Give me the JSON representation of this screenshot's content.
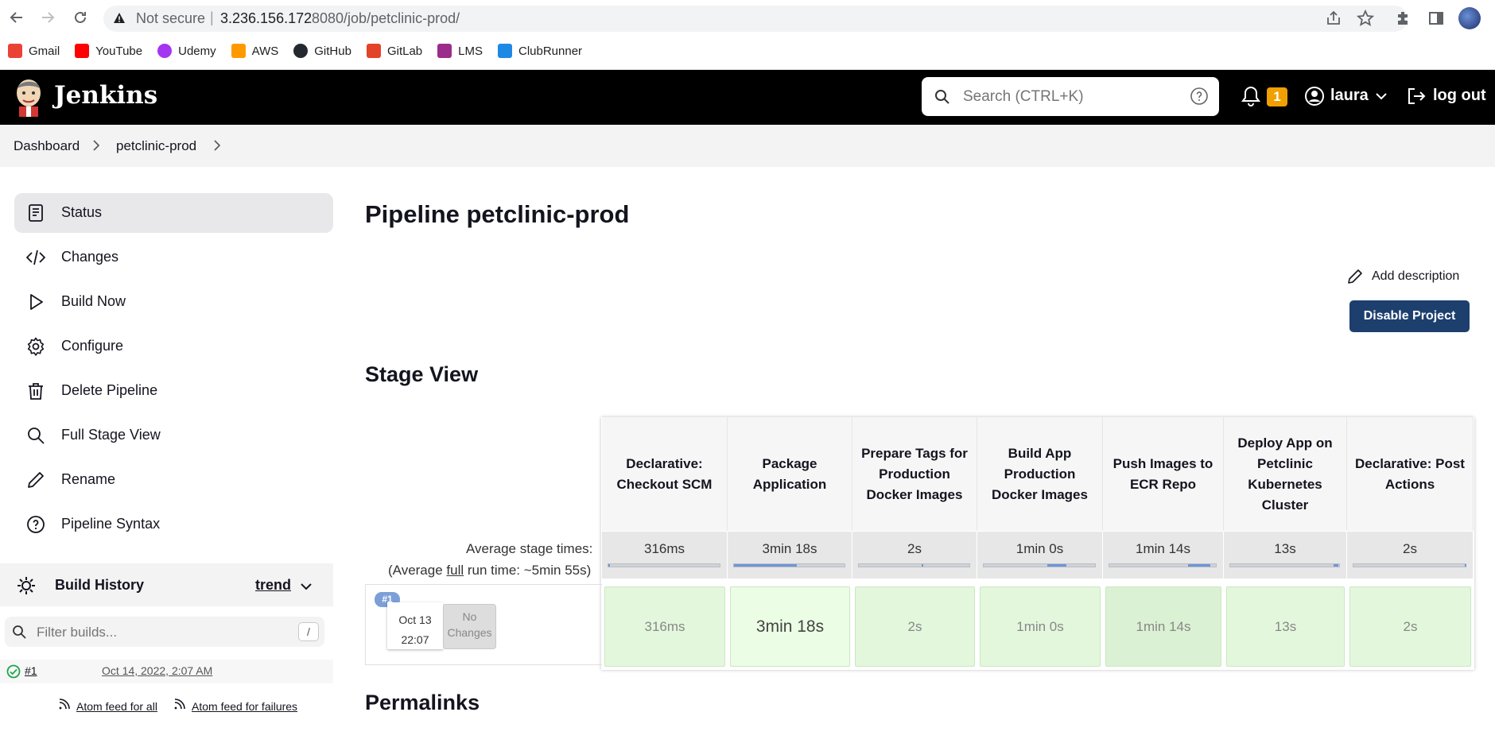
{
  "browser": {
    "not_secure": "Not secure",
    "separator": "|",
    "url_host": "3.236.156.172",
    "url_rest": ":8080/job/petclinic-prod/",
    "bookmarks": [
      {
        "label": "Gmail",
        "color": "#ea4335"
      },
      {
        "label": "YouTube",
        "color": "#ff0000"
      },
      {
        "label": "Udemy",
        "color": "#a435f0"
      },
      {
        "label": "AWS",
        "color": "#ff9900"
      },
      {
        "label": "GitHub",
        "color": "#24292f"
      },
      {
        "label": "GitLab",
        "color": "#e24329"
      },
      {
        "label": "LMS",
        "color": "#9b2c8a"
      },
      {
        "label": "ClubRunner",
        "color": "#1e88e5"
      }
    ]
  },
  "header": {
    "app_name": "Jenkins",
    "search_placeholder": "Search (CTRL+K)",
    "notification_count": "1",
    "user": "laura",
    "logout": "log out"
  },
  "breadcrumb": {
    "items": [
      "Dashboard",
      "petclinic-prod"
    ]
  },
  "sidebar": {
    "items": [
      {
        "label": "Status",
        "icon": "status-icon"
      },
      {
        "label": "Changes",
        "icon": "code-icon"
      },
      {
        "label": "Build Now",
        "icon": "play-icon"
      },
      {
        "label": "Configure",
        "icon": "gear-icon"
      },
      {
        "label": "Delete Pipeline",
        "icon": "trash-icon"
      },
      {
        "label": "Full Stage View",
        "icon": "search-icon"
      },
      {
        "label": "Rename",
        "icon": "pencil-icon"
      },
      {
        "label": "Pipeline Syntax",
        "icon": "help-icon"
      }
    ],
    "build_history": {
      "title": "Build History",
      "trend": "trend",
      "filter_placeholder": "Filter builds...",
      "filter_key": "/",
      "builds": [
        {
          "number": "#1",
          "date": "Oct 14, 2022, 2:07 AM",
          "status": "success"
        }
      ],
      "feed_all": "Atom feed for all",
      "feed_failures": "Atom feed for failures"
    }
  },
  "main": {
    "title": "Pipeline petclinic-prod",
    "add_description": "Add description",
    "disable_project": "Disable Project",
    "stage_view_title": "Stage View",
    "permalinks_title": "Permalinks"
  },
  "stage_view": {
    "avg_label": "Average stage times:",
    "avg_full_prefix": "(Average ",
    "avg_full_link": "full",
    "avg_full_suffix": " run time: ~5min 55s)",
    "run": {
      "badge": "#1",
      "date": "Oct 13",
      "time": "22:07",
      "changes_1": "No",
      "changes_2": "Changes"
    },
    "stages": [
      {
        "name": "Declarative: Checkout SCM",
        "avg": "316ms",
        "run": "316ms",
        "bar_start": 0.0,
        "bar_fraction": 0.01
      },
      {
        "name": "Package Application",
        "avg": "3min 18s",
        "run": "3min 18s",
        "bar_start": 0.0,
        "bar_fraction": 0.57
      },
      {
        "name": "Prepare Tags for Production Docker Images",
        "avg": "2s",
        "run": "2s",
        "bar_start": 0.57,
        "bar_fraction": 0.01
      },
      {
        "name": "Build App Production Docker Images",
        "avg": "1min 0s",
        "run": "1min 0s",
        "bar_start": 0.57,
        "bar_fraction": 0.17
      },
      {
        "name": "Push Images to ECR Repo",
        "avg": "1min 14s",
        "run": "1min 14s",
        "bar_start": 0.74,
        "bar_fraction": 0.21
      },
      {
        "name": "Deploy App on Petclinic Kubernetes Cluster",
        "avg": "13s",
        "run": "13s",
        "bar_start": 0.95,
        "bar_fraction": 0.04
      },
      {
        "name": "Declarative: Post Actions",
        "avg": "2s",
        "run": "2s",
        "bar_start": 0.99,
        "bar_fraction": 0.01
      }
    ]
  }
}
